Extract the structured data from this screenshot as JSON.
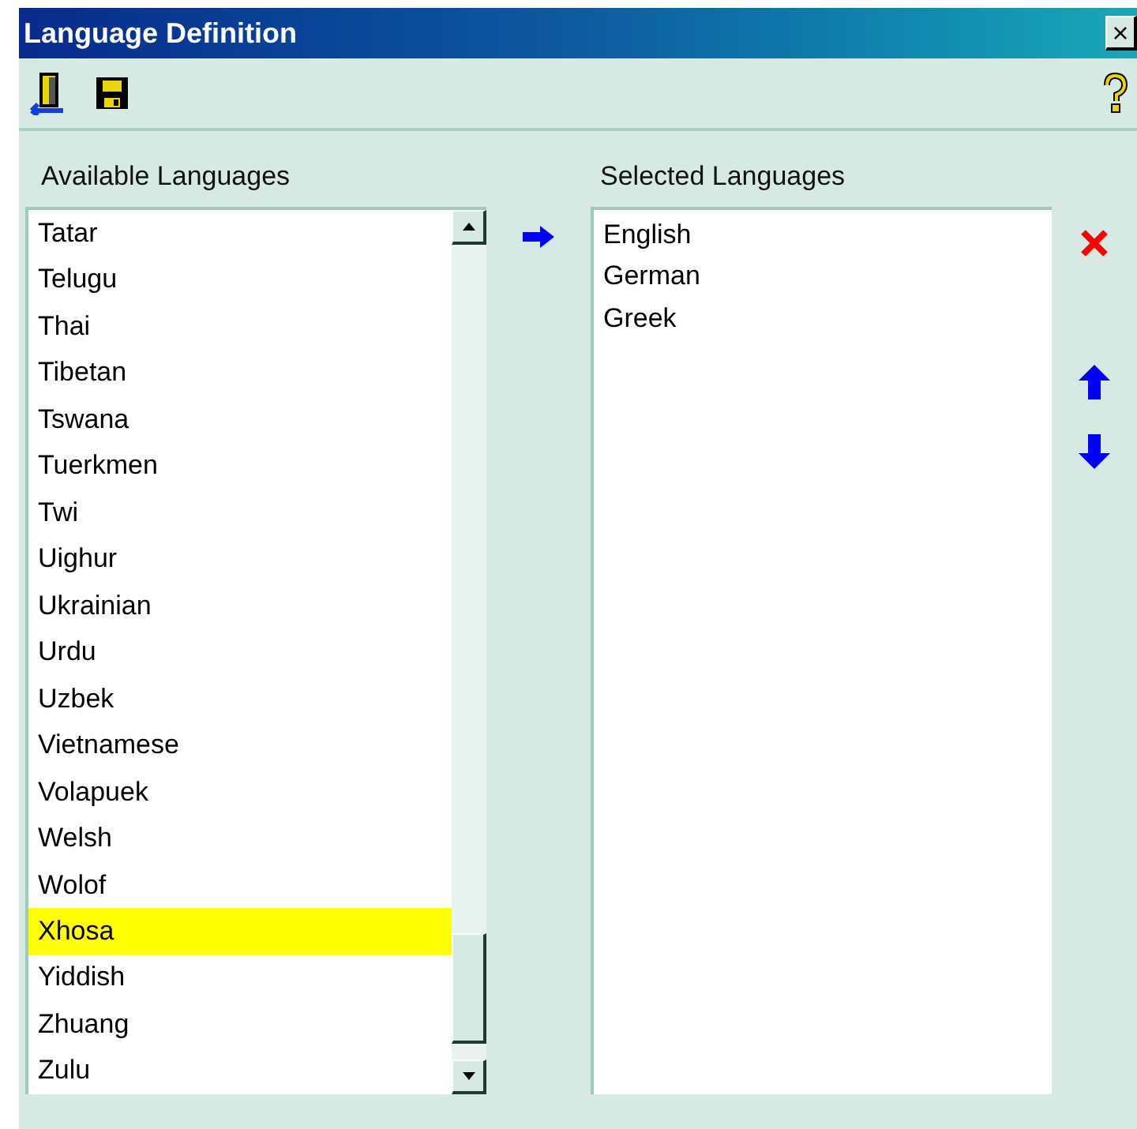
{
  "window": {
    "title": "Language Definition",
    "close": "×"
  },
  "available": {
    "label": "Available Languages",
    "items": [
      {
        "name": "Tatar",
        "selected": false
      },
      {
        "name": "Telugu",
        "selected": false
      },
      {
        "name": "Thai",
        "selected": false
      },
      {
        "name": "Tibetan",
        "selected": false
      },
      {
        "name": "Tswana",
        "selected": false
      },
      {
        "name": "Tuerkmen",
        "selected": false
      },
      {
        "name": "Twi",
        "selected": false
      },
      {
        "name": "Uighur",
        "selected": false
      },
      {
        "name": "Ukrainian",
        "selected": false
      },
      {
        "name": "Urdu",
        "selected": false
      },
      {
        "name": "Uzbek",
        "selected": false
      },
      {
        "name": "Vietnamese",
        "selected": false
      },
      {
        "name": "Volapuek",
        "selected": false
      },
      {
        "name": "Welsh",
        "selected": false
      },
      {
        "name": "Wolof",
        "selected": false
      },
      {
        "name": "Xhosa",
        "selected": true
      },
      {
        "name": "Yiddish",
        "selected": false
      },
      {
        "name": "Zhuang",
        "selected": false
      },
      {
        "name": "Zulu",
        "selected": false
      }
    ]
  },
  "selected": {
    "label": "Selected Languages",
    "items": [
      {
        "name": "English",
        "selected": false
      },
      {
        "name": "German",
        "selected": false
      },
      {
        "name": "Greek",
        "selected": false
      }
    ]
  }
}
